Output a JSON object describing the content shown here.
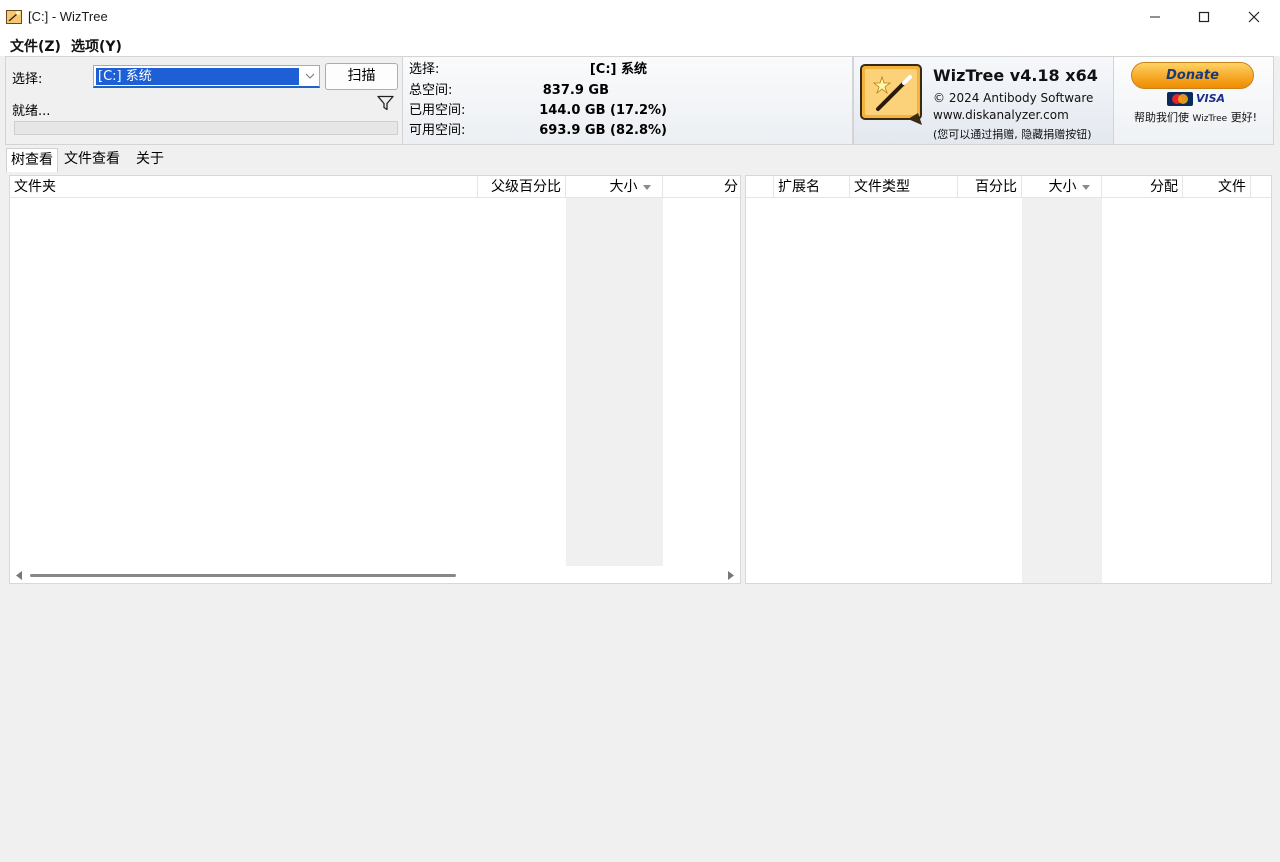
{
  "window": {
    "title": "[C:]  - WizTree"
  },
  "menu": [
    {
      "label": "文件(Z)"
    },
    {
      "label": "选项(Y)"
    }
  ],
  "scan_panel": {
    "select_label": "选择:",
    "drive_value": "[C:] 系统",
    "scan_button": "扫描",
    "status": "就绪..."
  },
  "info_panel": {
    "rows": [
      {
        "label": "选择:",
        "value": "[C:]  系统"
      },
      {
        "label": "总空间:",
        "value": "837.9 GB"
      },
      {
        "label": "已用空间:",
        "value": "144.0 GB  (17.2%)"
      },
      {
        "label": "可用空间:",
        "value": "693.9 GB  (82.8%)"
      }
    ]
  },
  "about": {
    "title": "WizTree v4.18 x64",
    "copyright": "© 2024 Antibody Software",
    "website": "www.diskanalyzer.com",
    "note": "(您可以通过捐赠, 隐藏捐赠按钮)"
  },
  "donate": {
    "button": "Donate",
    "card_visa": "VISA",
    "help_prefix": "帮助我们使",
    "help_brand": "WizTree",
    "help_suffix": "更好!"
  },
  "tabs": [
    {
      "label": "树查看",
      "active": true
    },
    {
      "label": "文件查看",
      "active": false
    },
    {
      "label": "关于",
      "active": false
    }
  ],
  "tree_columns": [
    "文件夹",
    "父级百分比",
    "大小",
    "分"
  ],
  "ext_columns": [
    "扩展名",
    "文件类型",
    "百分比",
    "大小",
    "分配",
    "文件"
  ],
  "colors": {
    "selection": "#1f5fd6",
    "donate": "#f5a623",
    "sorted_column": "#f0f0f0"
  }
}
